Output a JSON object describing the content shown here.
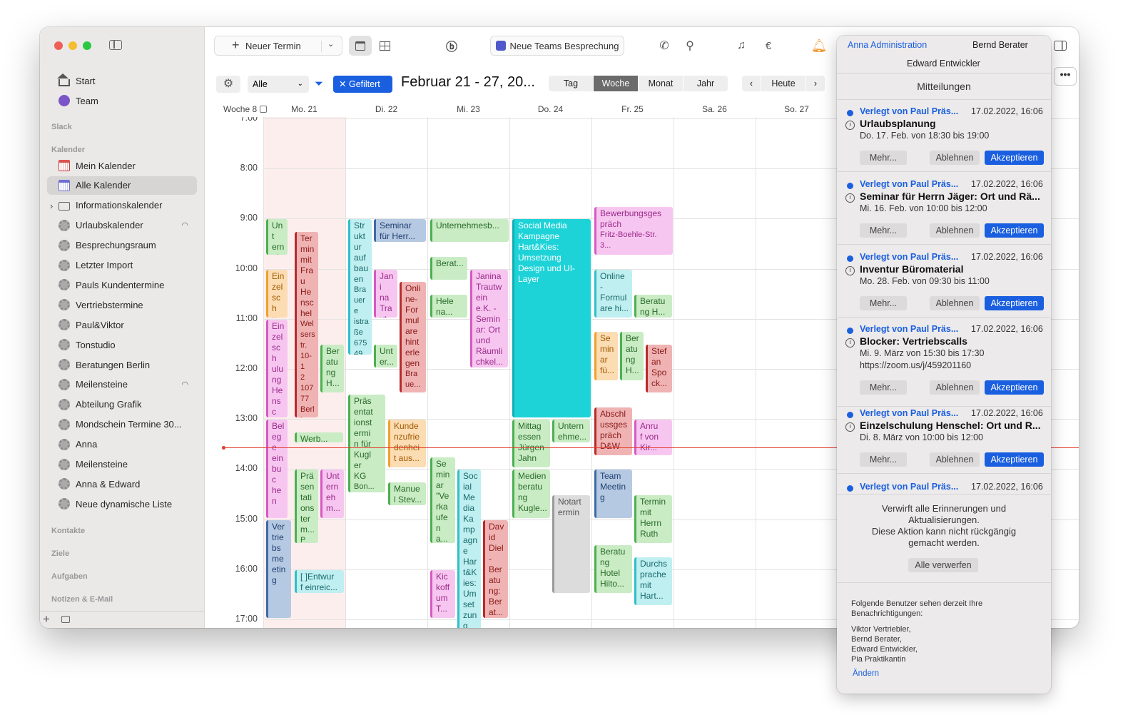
{
  "sidebar": {
    "items": [
      {
        "label": "Start",
        "icon": "house-icon"
      },
      {
        "label": "Team",
        "icon": "team-icon"
      }
    ],
    "sections": [
      "Slack",
      "Kalender",
      "Kontakte",
      "Ziele",
      "Aufgaben",
      "Notizen & E-Mail"
    ],
    "calendars": [
      "Mein Kalender",
      "Alle Kalender",
      "Informationskalender",
      "Urlaubskalender",
      "Besprechungsraum",
      "Letzter Import",
      "Pauls Kundentermine",
      "Vertriebstermine",
      "Paul&Viktor",
      "Tonstudio",
      "Beratungen Berlin",
      "Meilensteine",
      "Abteilung Grafik",
      "Mondschein Termine 30...",
      "Anna",
      "Meilensteine",
      "Anna & Edward",
      "Neue dynamische Liste"
    ],
    "add": "+"
  },
  "toolbar": {
    "new_event": "Neuer Termin",
    "teams": "Neue Teams Besprechung"
  },
  "filter": {
    "select": "Alle",
    "filtered": "Gefiltert",
    "range": "Februar 21 - 27, 20...",
    "views": [
      "Tag",
      "Woche",
      "Monat",
      "Jahr"
    ],
    "active_view": "Woche",
    "today": "Heute"
  },
  "header": {
    "week": "Woche 8",
    "days": [
      "Mo. 21",
      "Di. 22",
      "Mi. 23",
      "Do. 24",
      "Fr. 25",
      "Sa. 26",
      "So. 27"
    ]
  },
  "hours": [
    "7:00",
    "8:00",
    "9:00",
    "10:00",
    "11:00",
    "12:00",
    "13:00",
    "14:00",
    "15:00",
    "16:00",
    "17:00"
  ],
  "events": [
    {
      "t": "Unt\nern\neh\nm...",
      "c": "#c9ecc4",
      "fg": "#2a6a2a",
      "b": "#4caf50",
      "d": 0,
      "x": 0,
      "w": 30,
      "s": 9.0,
      "e": 9.75
    },
    {
      "t": "Ter\nmin\nmit\nFra\nu\nHe\nnsc\nhel",
      "sub": "Wel\nsers\ntr.\n10-1\n2\n107\n77\nBerl\nin\nDeu\nts...",
      "c": "#f0b3b3",
      "fg": "#8a1a1a",
      "b": "#b52b2b",
      "d": 0,
      "x": 40,
      "w": 33,
      "s": 9.25,
      "e": 13.0
    },
    {
      "t": "Ein\nzel\nsch\nul...",
      "c": "#fbdcb3",
      "fg": "#a05a00",
      "b": "#f0a030",
      "d": 0,
      "x": 0,
      "w": 30,
      "s": 10.0,
      "e": 11.0
    },
    {
      "t": "Ein\nzel\nsch\nulu\nng\nHe\nnsc\nhel:\nM...",
      "c": "#f7c6f0",
      "fg": "#9a2a8a",
      "b": "#d45ac0",
      "d": 0,
      "x": 0,
      "w": 30,
      "s": 11.0,
      "e": 13.0
    },
    {
      "t": "Ber\natu\nng\nH...",
      "c": "#c9ecc4",
      "fg": "#2a6a2a",
      "b": "#4caf50",
      "d": 0,
      "x": 76,
      "w": 33,
      "s": 11.5,
      "e": 12.5
    },
    {
      "t": "Bel\nege\nein\nbuc\nhen",
      "c": "#f7c6f0",
      "fg": "#9a2a8a",
      "b": "#d45ac0",
      "d": 0,
      "x": 0,
      "w": 30,
      "s": 13.0,
      "e": 15.0
    },
    {
      "t": "Werb...",
      "c": "#c9ecc4",
      "fg": "#2a6a2a",
      "b": "#4caf50",
      "d": 0,
      "x": 40,
      "w": 68,
      "s": 13.25,
      "e": 13.5
    },
    {
      "t": "Prä\nsen\ntati\nons\nter\nm...",
      "sub": "Pa...",
      "c": "#c9ecc4",
      "fg": "#2a6a2a",
      "b": "#4caf50",
      "d": 0,
      "x": 40,
      "w": 33,
      "s": 14.0,
      "e": 15.5
    },
    {
      "t": "Unt\nern\neh\nm...",
      "c": "#f7c6f0",
      "fg": "#9a2a8a",
      "b": "#d45ac0",
      "d": 0,
      "x": 76,
      "w": 33,
      "s": 14.0,
      "e": 15.0
    },
    {
      "t": "Ver\ntrie\nbs\nme\netin\ng",
      "c": "#b5c9e2",
      "fg": "#1f3f6f",
      "b": "#3d6aa8",
      "d": 0,
      "x": 0,
      "w": 35,
      "s": 15.0,
      "e": 17.0
    },
    {
      "t": "[ ]Entwur\nf einreic...",
      "c": "#bfeff0",
      "fg": "#1a6a6e",
      "b": "#2fbfc7",
      "d": 0,
      "x": 40,
      "w": 69,
      "s": 16.0,
      "e": 16.5
    },
    {
      "t": "Str\nukt\nur\nauf\nbau\nen",
      "sub": "Bra\nuere\nistra\nße\n675\n49\nW...",
      "c": "#bfeff0",
      "fg": "#1a6a6e",
      "b": "#2fbfc7",
      "d": 1,
      "x": 0,
      "w": 33,
      "s": 9.0,
      "e": 11.75
    },
    {
      "t": "Seminar\nfür Herr...",
      "c": "#b5c9e2",
      "fg": "#1f3f6f",
      "b": "#3d6aa8",
      "d": 1,
      "x": 36,
      "w": 73,
      "s": 9.0,
      "e": 9.5
    },
    {
      "t": "Jani\nna\nTra\nut...",
      "c": "#f7c6f0",
      "fg": "#9a2a8a",
      "b": "#d45ac0",
      "d": 1,
      "x": 36,
      "w": 33,
      "s": 10.0,
      "e": 11.0
    },
    {
      "t": "Onli\nne-\nFor\nmul\nare\nhint\nerle\ngen",
      "sub": "Bra\nue...",
      "c": "#f0b3b3",
      "fg": "#8a1a1a",
      "b": "#b52b2b",
      "d": 1,
      "x": 72,
      "w": 37,
      "s": 10.25,
      "e": 12.5
    },
    {
      "t": "Unt\ner...",
      "c": "#c9ecc4",
      "fg": "#2a6a2a",
      "b": "#4caf50",
      "d": 1,
      "x": 36,
      "w": 33,
      "s": 11.5,
      "e": 12.0
    },
    {
      "t": "Präs\nentat\nionst\nermi\nn für\nKugl\ner\nKG",
      "sub": "Bon...",
      "c": "#c9ecc4",
      "fg": "#2a6a2a",
      "b": "#4caf50",
      "d": 1,
      "x": 0,
      "w": 52,
      "s": 12.5,
      "e": 14.5
    },
    {
      "t": "Kunde\nnzufrie\ndenhei\nt aus...",
      "c": "#fbdcb3",
      "fg": "#a05a00",
      "b": "#f0a030",
      "d": 1,
      "x": 56,
      "w": 53,
      "s": 13.0,
      "e": 14.0
    },
    {
      "t": "Manue\nl Stev...",
      "c": "#c9ecc4",
      "fg": "#2a6a2a",
      "b": "#4caf50",
      "d": 1,
      "x": 56,
      "w": 53,
      "s": 14.25,
      "e": 14.75
    },
    {
      "t": "Unternehmesb...",
      "c": "#c9ecc4",
      "fg": "#2a6a2a",
      "b": "#4caf50",
      "d": 2,
      "x": 0,
      "w": 110,
      "s": 9.0,
      "e": 9.5
    },
    {
      "t": "Berat...",
      "c": "#c9ecc4",
      "fg": "#2a6a2a",
      "b": "#4caf50",
      "d": 2,
      "x": 0,
      "w": 52,
      "s": 9.75,
      "e": 10.25
    },
    {
      "t": "Hele\nna...",
      "c": "#c9ecc4",
      "fg": "#2a6a2a",
      "b": "#4caf50",
      "d": 2,
      "x": 0,
      "w": 52,
      "s": 10.5,
      "e": 11.0
    },
    {
      "t": "Janina\nTrautw\nein\ne.K. -\nSemin\nar: Ort\nund\nRäumli\nchkel...",
      "c": "#f7c6f0",
      "fg": "#9a2a8a",
      "b": "#d45ac0",
      "d": 2,
      "x": 56,
      "w": 53,
      "s": 10.0,
      "e": 12.0
    },
    {
      "t": "Se\nmin\nar\n\"Ve\nrka\nufe\nn\na...",
      "c": "#c9ecc4",
      "fg": "#2a6a2a",
      "b": "#4caf50",
      "d": 2,
      "x": 0,
      "w": 35,
      "s": 13.75,
      "e": 15.5
    },
    {
      "t": "Soc\nial\nMe\ndia\nKa\nmp\nagn\ne\nHar\nt&K\nies:\nUm\nset\nzun\ng",
      "c": "#bfeff0",
      "fg": "#1a6a6e",
      "b": "#2fbfc7",
      "d": 2,
      "x": 38,
      "w": 33,
      "s": 14.0,
      "e": 17.25
    },
    {
      "t": "Dav\nid\nDiel\n-\nBer\natu\nng:\nBer\nat...",
      "c": "#f0b3b3",
      "fg": "#8a1a1a",
      "b": "#b52b2b",
      "d": 2,
      "x": 74,
      "w": 35,
      "s": 15.0,
      "e": 17.0
    },
    {
      "t": "Kic\nkoff\num\nT...",
      "c": "#f7c6f0",
      "fg": "#9a2a8a",
      "b": "#d45ac0",
      "d": 2,
      "x": 0,
      "w": 35,
      "s": 16.0,
      "e": 17.0
    },
    {
      "t": "Social Media\nKampagne\nHart&Kies:\nUmsetzung\nDesign und UI-\nLayer",
      "c": "#1ed3d8",
      "fg": "#ffffff",
      "b": "#10aeb3",
      "d": 3,
      "x": 0,
      "w": 110,
      "s": 9.0,
      "e": 13.0
    },
    {
      "t": "Mittag\nessen\nJürgen\nJahn",
      "c": "#c9ecc4",
      "fg": "#2a6a2a",
      "b": "#4caf50",
      "d": 3,
      "x": 0,
      "w": 53,
      "s": 13.0,
      "e": 14.0
    },
    {
      "t": "Untern\nehme...",
      "c": "#c9ecc4",
      "fg": "#2a6a2a",
      "b": "#4caf50",
      "d": 3,
      "x": 56,
      "w": 53,
      "s": 13.0,
      "e": 13.5
    },
    {
      "t": "Medien\nberatu\nng\nKugle...",
      "c": "#c9ecc4",
      "fg": "#2a6a2a",
      "b": "#4caf50",
      "d": 3,
      "x": 0,
      "w": 53,
      "s": 14.0,
      "e": 15.0
    },
    {
      "t": "Notart\nermin",
      "c": "#dcdcdc",
      "fg": "#555555",
      "b": "#999999",
      "d": 3,
      "x": 56,
      "w": 53,
      "s": 14.5,
      "e": 16.5
    },
    {
      "t": "Bewerbungsges\npräch",
      "sub": "Fritz-Boehle-Str.\n3...",
      "c": "#f7c6f0",
      "fg": "#9a2a8a",
      "b": "#d45ac0",
      "d": 4,
      "x": 0,
      "w": 110,
      "s": 8.75,
      "e": 9.75
    },
    {
      "t": "Online\n-\nFormul\nare hi...",
      "c": "#bfeff0",
      "fg": "#1a6a6e",
      "b": "#2fbfc7",
      "d": 4,
      "x": 0,
      "w": 53,
      "s": 10.0,
      "e": 11.0
    },
    {
      "t": "Beratu\nng H...",
      "c": "#c9ecc4",
      "fg": "#2a6a2a",
      "b": "#4caf50",
      "d": 4,
      "x": 56,
      "w": 53,
      "s": 10.5,
      "e": 11.0
    },
    {
      "t": "Se\nmin\nar\nfü...",
      "c": "#fbdcb3",
      "fg": "#a05a00",
      "b": "#f0a030",
      "d": 4,
      "x": 0,
      "w": 33,
      "s": 11.25,
      "e": 12.25
    },
    {
      "t": "Ber\natu\nng\nH...",
      "c": "#c9ecc4",
      "fg": "#2a6a2a",
      "b": "#4caf50",
      "d": 4,
      "x": 36,
      "w": 33,
      "s": 11.25,
      "e": 12.25
    },
    {
      "t": "Stef\nan\nSpo\nck...",
      "c": "#f0b3b3",
      "fg": "#8a1a1a",
      "b": "#b52b2b",
      "d": 4,
      "x": 72,
      "w": 37,
      "s": 11.5,
      "e": 12.5
    },
    {
      "t": "Abschl\nussges\npräch\nD&W",
      "c": "#f0b3b3",
      "fg": "#8a1a1a",
      "b": "#b52b2b",
      "d": 4,
      "x": 0,
      "w": 53,
      "s": 12.75,
      "e": 13.75
    },
    {
      "t": "Anru\nf von\nKir...",
      "c": "#f7c6f0",
      "fg": "#9a2a8a",
      "b": "#d45ac0",
      "d": 4,
      "x": 56,
      "w": 53,
      "s": 13.0,
      "e": 13.75
    },
    {
      "t": "Team\nMeetin\ng",
      "c": "#b5c9e2",
      "fg": "#1f3f6f",
      "b": "#3d6aa8",
      "d": 4,
      "x": 0,
      "w": 53,
      "s": 14.0,
      "e": 15.0
    },
    {
      "t": "Termin\nmit\nHerrn\nRuth",
      "c": "#c9ecc4",
      "fg": "#2a6a2a",
      "b": "#4caf50",
      "d": 4,
      "x": 56,
      "w": 53,
      "s": 14.5,
      "e": 15.5
    },
    {
      "t": "Beratu\nng\nHotel\nHilto...",
      "c": "#c9ecc4",
      "fg": "#2a6a2a",
      "b": "#4caf50",
      "d": 4,
      "x": 0,
      "w": 53,
      "s": 15.5,
      "e": 16.5
    },
    {
      "t": "Durchs\nprache\nmit\nHart...",
      "c": "#bfeff0",
      "fg": "#1a6a6e",
      "b": "#2fbfc7",
      "d": 4,
      "x": 56,
      "w": 53,
      "s": 15.75,
      "e": 16.75
    }
  ],
  "panel": {
    "users": [
      "Anna Administration",
      "Bernd Berater",
      "Edward Entwickler"
    ],
    "title": "Mitteilungen",
    "notes": [
      {
        "from": "Verlegt von Paul Präs...",
        "date": "17.02.2022, 16:06",
        "title": "Urlaubsplanung",
        "when": "Do. 17. Feb. von 18:30 bis 19:00",
        "extra": ""
      },
      {
        "from": "Verlegt von Paul Präs...",
        "date": "17.02.2022, 16:06",
        "title": "Seminar für Herrn Jäger: Ort und Rä...",
        "when": "Mi. 16. Feb. von 10:00 bis 12:00",
        "extra": ""
      },
      {
        "from": "Verlegt von Paul Präs...",
        "date": "17.02.2022, 16:06",
        "title": "Inventur Büromaterial",
        "when": "Mo. 28. Feb. von 09:30 bis 11:00",
        "extra": ""
      },
      {
        "from": "Verlegt von Paul Präs...",
        "date": "17.02.2022, 16:06",
        "title": "Blocker: Vertriebscalls",
        "when": "Mi. 9. März von 15:30 bis 17:30",
        "extra": "https://zoom.us/j/459201160"
      },
      {
        "from": "Verlegt von Paul Präs...",
        "date": "17.02.2022, 16:06",
        "title": "Einzelschulung Henschel: Ort und R...",
        "when": "Di. 8. März von 10:00 bis 12:00",
        "extra": ""
      }
    ],
    "last_from": "Verlegt von Paul Präs...",
    "last_date": "17.02.2022, 16:06",
    "btn_more": "Mehr...",
    "btn_decline": "Ablehnen",
    "btn_accept": "Akzeptieren",
    "discard_text": [
      "Verwirft alle Erinnerungen und",
      "Aktualisierungen.",
      "Diese Aktion kann nicht rückgängig",
      "gemacht werden."
    ],
    "discard_btn": "Alle verwerfen",
    "viewers_label": [
      "Folgende Benutzer sehen derzeit Ihre",
      "Benachrichtigungen:"
    ],
    "viewers": [
      "Viktor Vertriebler,",
      "Bernd Berater,",
      "Edward Entwickler,",
      "Pia Praktikantin"
    ],
    "change": "Ändern"
  }
}
